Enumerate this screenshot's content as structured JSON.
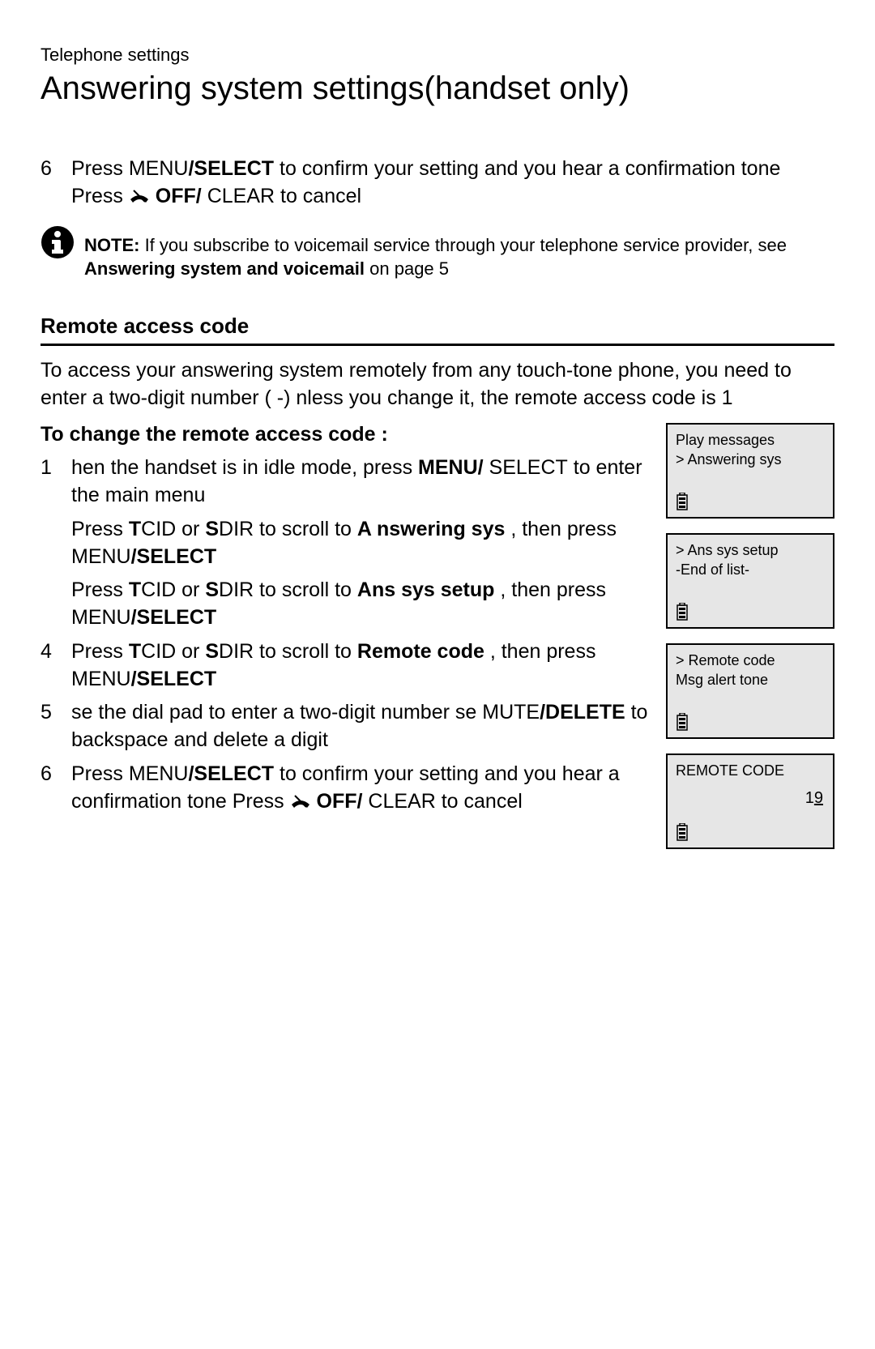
{
  "breadcrumb": "Telephone settings",
  "title": "Answering system settings(handset only)",
  "top_step": {
    "num": "6",
    "text_a": "Press ",
    "key1": "MENU",
    "key1b": "/SELECT",
    "text_b": " to confirm your setting   and you hear a  confirmation tone  Press ",
    "key2a": " OFF/",
    "key2b": " CLEAR",
    "text_c": " to cancel"
  },
  "note": {
    "label": "NOTE:",
    "body_a": " If you subscribe to voicemail service through your telephone service provider, see ",
    "bold": "Answering system and voicemail",
    "body_b": "    on page 5"
  },
  "section_heading": "Remote access code",
  "section_para": "To access your answering system remotely from any      touch-tone  phone, you need to enter a two-digit number (     -) nless you change it, the remote access code is 1",
  "sub_heading": "To change the remote access code  :",
  "steps": [
    {
      "num": "1",
      "frag_a": "hen the handset is in idle mode, press       ",
      "key1": "MENU/",
      "key1b": " SELECT",
      "frag_b": " to enter the main menu"
    },
    {
      "num": "",
      "frag_a": "Press  ",
      "key_t": "T",
      "key_cid": "CID",
      "frag_or": " or  ",
      "key_s": "S",
      "key_dir": "DIR",
      "frag_b": " to scroll to  ",
      "target": "A  nswering sys",
      "frag_c": " , then press ",
      "keym": "MENU",
      "keymb": "/SELECT"
    },
    {
      "num": "",
      "frag_a": "Press  ",
      "key_t": "T",
      "key_cid": "CID",
      "frag_or": " or  ",
      "key_s": "S",
      "key_dir": "DIR",
      "frag_b": " to scroll to    ",
      "target": "Ans sys setup",
      "frag_c": " , then press ",
      "keym": "MENU",
      "keymb": "/SELECT"
    },
    {
      "num": "4",
      "frag_a": "Press  ",
      "key_t": "T",
      "key_cid": "CID",
      "frag_or": " or  ",
      "key_s": "S",
      "key_dir": "DIR",
      "frag_b": " to scroll to  ",
      "target": "Remote code",
      "frag_c": "   , then press ",
      "keym": "MENU",
      "keymb": "/SELECT"
    },
    {
      "num": "5",
      "frag_a": "se the dial pad to enter a      two-digit number se ",
      "key1": "MUTE",
      "key1b": "/DELETE",
      "frag_b": "  to backspace and delete a digit"
    },
    {
      "num": "6",
      "frag_a": "Press ",
      "key1": "MENU",
      "key1b": "/SELECT",
      "frag_b": "  to confirm your setting   and you hear  a confirmation tone   Press ",
      "key2a": " OFF/",
      "key2b": " CLEAR",
      "frag_c": " to cancel"
    }
  ],
  "lcd": [
    {
      "l1": "  Play messages",
      "l2": "> Answering sys"
    },
    {
      "l1": " > Ans sys setup",
      "l2": " -End of list-"
    },
    {
      "l1": " > Remote code",
      "l2": "   Msg alert tone"
    },
    {
      "l1": "  REMOTE CODE",
      "code_a": "1",
      "code_b": "9"
    }
  ]
}
